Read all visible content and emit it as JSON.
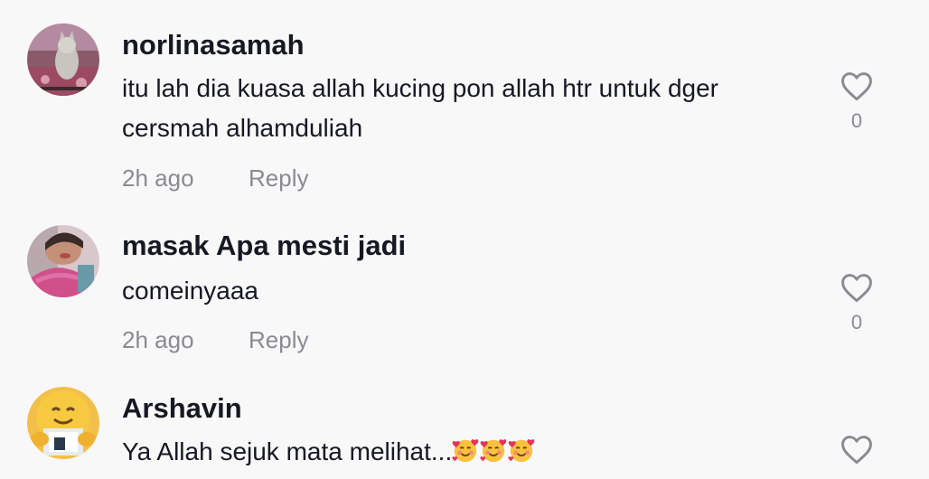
{
  "comments": [
    {
      "username": "norlinasamah",
      "text": "itu lah dia kuasa allah kucing pon allah htr untuk dger cersmah alhamduliah",
      "time": "2h ago",
      "reply_label": "Reply",
      "like_count": "0",
      "avatar_icon": "cat-photo-avatar"
    },
    {
      "username": "masak Apa mesti jadi",
      "text": "comeinyaaa",
      "time": "2h ago",
      "reply_label": "Reply",
      "like_count": "0",
      "avatar_icon": "person-photo-avatar"
    },
    {
      "username": "Arshavin",
      "text": "Ya Allah sejuk mata melihat...",
      "emojis": [
        "smiling-face-with-hearts",
        "smiling-face-with-hearts",
        "smiling-face-with-hearts"
      ],
      "avatar_icon": "hugging-emoji-avatar"
    }
  ],
  "colors": {
    "background": "#f8f8f8",
    "primary_text": "#161823",
    "secondary_text": "#8a8b91",
    "heart_outline": "#8a8b91"
  },
  "icons": {
    "like": "heart-outline-icon"
  }
}
